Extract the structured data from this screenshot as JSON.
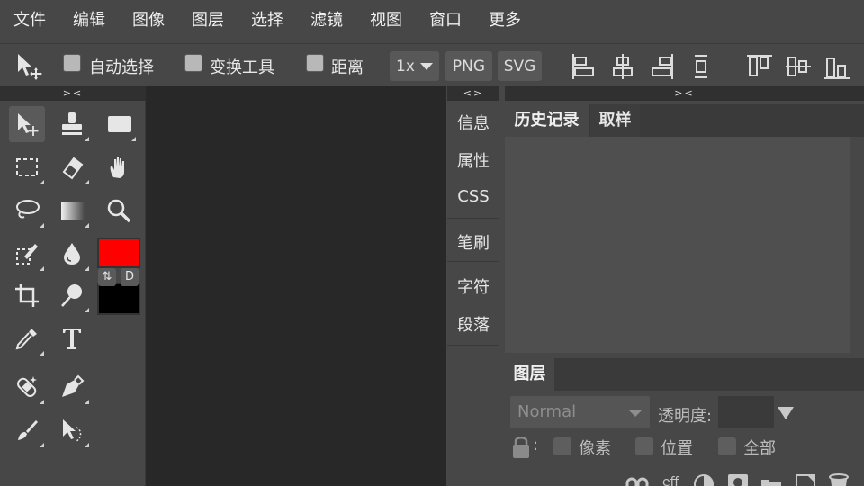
{
  "menu": [
    "文件",
    "编辑",
    "图像",
    "图层",
    "选择",
    "滤镜",
    "视图",
    "窗口",
    "更多"
  ],
  "options": {
    "auto_select": "自动选择",
    "transform": "变换工具",
    "distance": "距离",
    "zoom": "1x",
    "png": "PNG",
    "svg": "SVG"
  },
  "collapse_left": "><",
  "collapse_mid": "<>",
  "collapse_right": "><",
  "side_tabs": [
    "信息",
    "属性",
    "CSS",
    "笔刷",
    "字符",
    "段落"
  ],
  "panel_tabs": {
    "history": "历史记录",
    "sample": "取样"
  },
  "layers": {
    "title": "图层",
    "blend_mode": "Normal",
    "opacity_label": "透明度:",
    "lock_colon": ":",
    "lock_pixels": "像素",
    "lock_position": "位置",
    "lock_all": "全部"
  },
  "swatch": {
    "swap": "⇅",
    "default": "D"
  },
  "layer_footer_text": "eff",
  "colors": {
    "foreground": "#ff0000",
    "background": "#000000",
    "ui_bg": "#474747",
    "canvas": "#282828"
  }
}
